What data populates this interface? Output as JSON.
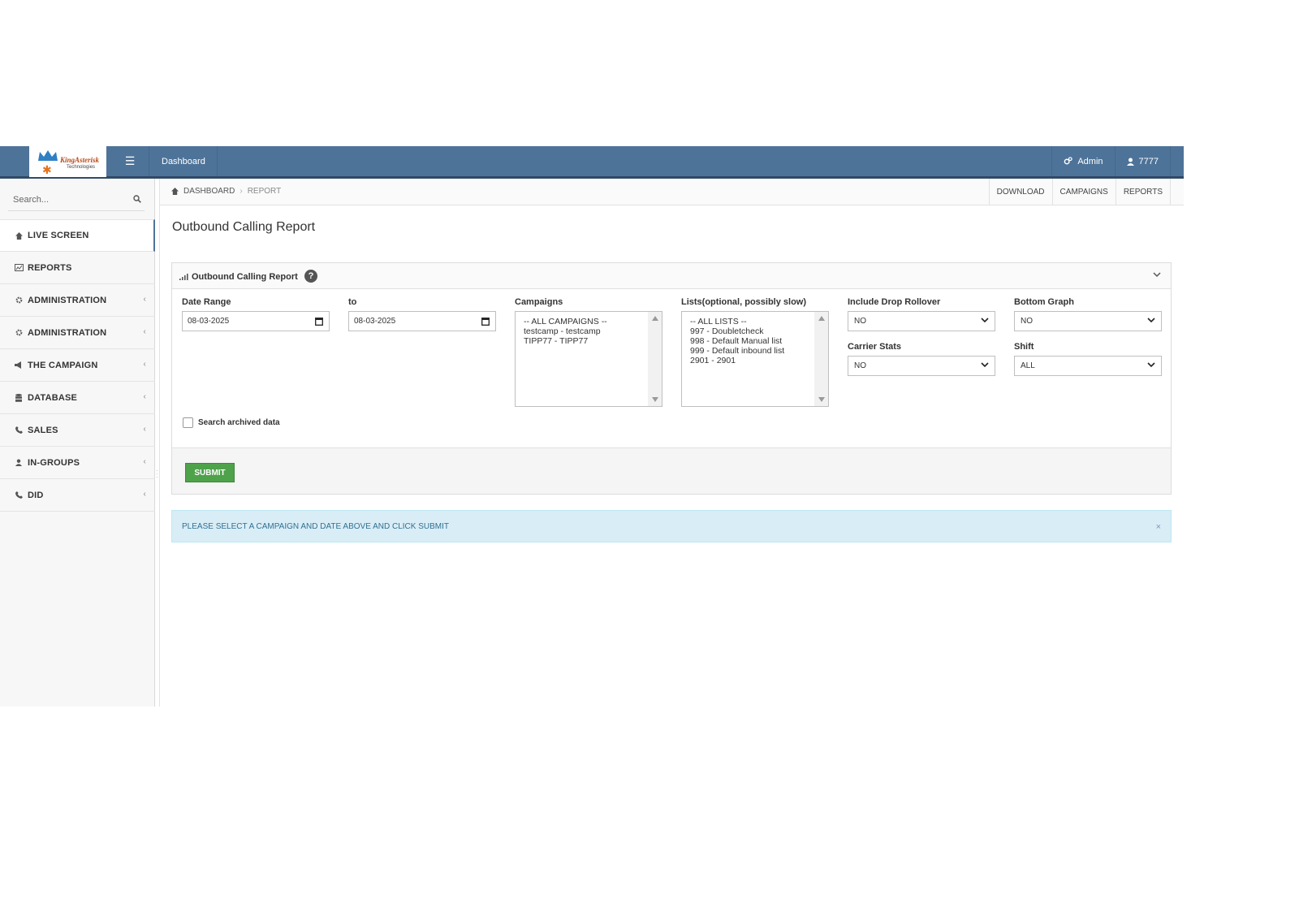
{
  "topbar": {
    "logo_text": "KingAsterisk",
    "logo_sub": "Technologies",
    "dashboard_label": "Dashboard",
    "admin_label": "Admin",
    "user_label": "7777"
  },
  "sidebar": {
    "search_placeholder": "Search...",
    "items": [
      {
        "label": "LIVE SCREEN",
        "icon": "home-icon",
        "active": true
      },
      {
        "label": "REPORTS",
        "icon": "chart-icon"
      },
      {
        "label": "ADMINISTRATION",
        "icon": "gear-icon"
      },
      {
        "label": "ADMINISTRATION",
        "icon": "gear-icon"
      },
      {
        "label": "THE CAMPAIGN",
        "icon": "megaphone-icon"
      },
      {
        "label": "DATABASE",
        "icon": "database-icon"
      },
      {
        "label": "SALES",
        "icon": "phone-icon"
      },
      {
        "label": "IN-GROUPS",
        "icon": "user-icon"
      },
      {
        "label": "DID",
        "icon": "phone-icon"
      }
    ]
  },
  "breadcrumb": {
    "home": "DASHBOARD",
    "current": "REPORT",
    "links": [
      "DOWNLOAD",
      "CAMPAIGNS",
      "REPORTS"
    ]
  },
  "page_title": "Outbound Calling Report",
  "panel": {
    "title": "Outbound Calling Report",
    "help": "?",
    "date_range_label": "Date Range",
    "date_from": "08-03-2025",
    "to_label": "to",
    "date_to": "08-03-2025",
    "campaigns_label": "Campaigns",
    "campaigns": [
      "-- ALL CAMPAIGNS --",
      "testcamp - testcamp",
      "TIPP77 - TIPP77"
    ],
    "lists_label": "Lists(optional, possibly slow)",
    "lists": [
      "-- ALL LISTS --",
      "997 - Doubletcheck",
      "998 - Default Manual list",
      "999 - Default inbound list",
      "2901 - 2901"
    ],
    "drop_rollover_label": "Include Drop Rollover",
    "drop_rollover_value": "NO",
    "bottom_graph_label": "Bottom Graph",
    "bottom_graph_value": "NO",
    "carrier_stats_label": "Carrier Stats",
    "carrier_stats_value": "NO",
    "shift_label": "Shift",
    "shift_value": "ALL",
    "archived_label": "Search archived data",
    "submit_label": "SUBMIT"
  },
  "alert": {
    "message": "PLEASE SELECT A CAMPAIGN AND DATE ABOVE AND CLICK SUBMIT",
    "close": "×"
  },
  "colors": {
    "navbar": "#4e7399",
    "submit": "#4ea24a",
    "alert_bg": "#d9edf7"
  }
}
